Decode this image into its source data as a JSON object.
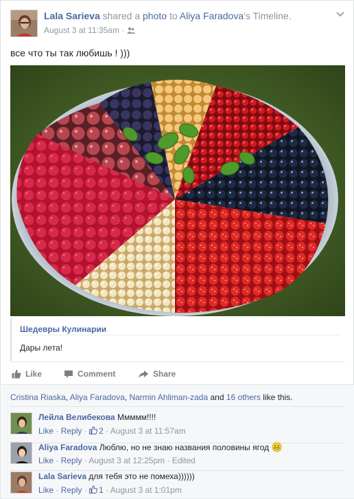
{
  "post": {
    "author": "Lala Sarieva",
    "shared_text": "shared a",
    "photo_link": "photo",
    "to_text": "to",
    "target": "Aliya Faradova",
    "timeline_suffix": "'s Timeline.",
    "timestamp": "August 3 at 11:35am",
    "dot": "·",
    "status": "все что ты так любишь ! )))"
  },
  "attachment": {
    "page_name": "Шедевры Кулинарии",
    "description": "Дары лета!"
  },
  "actions": {
    "like": "Like",
    "comment": "Comment",
    "share": "Share"
  },
  "likes": {
    "names": [
      "Cristina Riaska",
      "Aliya Faradova",
      "Narmin Ahliman-zada"
    ],
    "sep": ", ",
    "and": " and ",
    "others": "16 others",
    "suffix": " like this."
  },
  "comments": [
    {
      "author": "Лейла Велибекова",
      "text": "Ммммм!!!!",
      "like": "Like",
      "reply": "Reply",
      "like_count": "2",
      "time": "August 3 at 11:57am",
      "edited": ""
    },
    {
      "author": "Aliya Faradova",
      "text": "Люблю, но не знаю названия половины ягод",
      "like": "Like",
      "reply": "Reply",
      "like_count": "",
      "time": "August 3 at 12:25pm",
      "edited": "Edited"
    },
    {
      "author": "Lala Sarieva",
      "text": "для тебя это не помеха))))))",
      "like": "Like",
      "reply": "Reply",
      "like_count": "1",
      "time": "August 3 at 1:01pm",
      "edited": ""
    }
  ],
  "meta_sep": " · ",
  "colors": {
    "link": "#4b67a1",
    "meta": "#90949c",
    "feedback_bg": "#f6f7f9"
  }
}
